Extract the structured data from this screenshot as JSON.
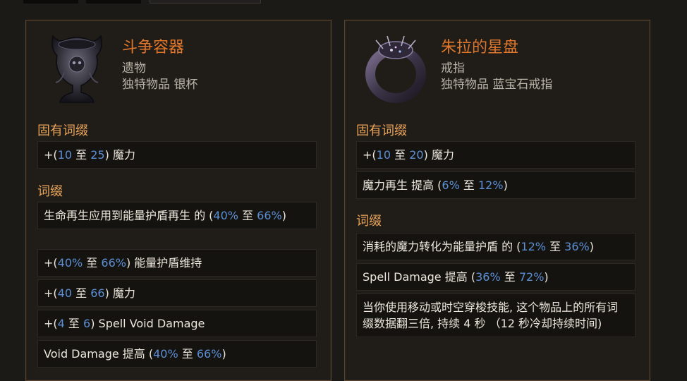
{
  "cards": [
    {
      "name": "斗争容器",
      "type": "遗物",
      "rarity": "独特物品 银杯",
      "implicit_title": "固有词缀",
      "implicit": [
        {
          "pre": "+(",
          "a": "10",
          "mid": " 至 ",
          "b": "25",
          "post": ") 魔力"
        }
      ],
      "explicit_title": "词缀",
      "explicit": [
        {
          "pre": "生命再生应用到能量护盾再生 的 (",
          "a": "40%",
          "mid": " 至 ",
          "b": "66%",
          "post": ")"
        },
        {
          "pre": "+(",
          "a": "40%",
          "mid": " 至 ",
          "b": "66%",
          "post": ") 能量护盾维持"
        },
        {
          "pre": "+(",
          "a": "40",
          "mid": " 至 ",
          "b": "66",
          "post": ") 魔力"
        },
        {
          "pre": "+(",
          "a": "4",
          "mid": " 至 ",
          "b": "6",
          "post": ") Spell Void Damage"
        },
        {
          "pre": "Void Damage 提高 (",
          "a": "40%",
          "mid": " 至 ",
          "b": "66%",
          "post": ")"
        }
      ]
    },
    {
      "name": "朱拉的星盘",
      "type": "戒指",
      "rarity": "独特物品 蓝宝石戒指",
      "implicit_title": "固有词缀",
      "implicit": [
        {
          "pre": "+(",
          "a": "10",
          "mid": " 至 ",
          "b": "20",
          "post": ") 魔力"
        },
        {
          "pre": "魔力再生 提高 (",
          "a": "6%",
          "mid": " 至 ",
          "b": "12%",
          "post": ")"
        }
      ],
      "explicit_title": "词缀",
      "explicit": [
        {
          "pre": "消耗的魔力转化为能量护盾 的 (",
          "a": "12%",
          "mid": " 至 ",
          "b": "36%",
          "post": ")"
        },
        {
          "pre": "Spell Damage 提高 (",
          "a": "36%",
          "mid": " 至 ",
          "b": "72%",
          "post": ")"
        },
        {
          "text": "当你使用移动或时空穿梭技能, 这个物品上的所有词缀数据翻三倍, 持续 4 秒 （12 秒冷却持续时间)"
        }
      ]
    }
  ],
  "icons": {
    "card1": "silver-cup-icon",
    "card2": "sapphire-ring-icon"
  },
  "colors": {
    "name": "#e0772b",
    "section": "#e9a45a",
    "value": "#5b8fd6",
    "border": "#5d4630"
  }
}
